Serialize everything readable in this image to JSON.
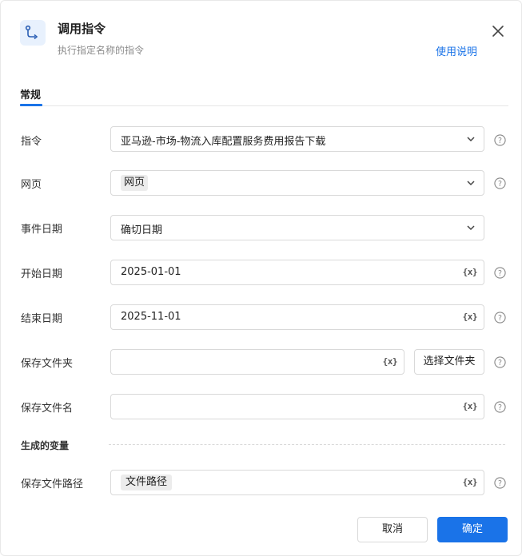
{
  "header": {
    "title": "调用指令",
    "subtitle": "执行指定名称的指令",
    "help_link": "使用说明",
    "accent": "#1a73e8"
  },
  "tabs": [
    {
      "label": "常规",
      "active": true
    }
  ],
  "form": {
    "command": {
      "label": "指令",
      "value": "亚马逊-市场-物流入库配置服务费用报告下载"
    },
    "webpage": {
      "label": "网页",
      "tag": "网页"
    },
    "event_date": {
      "label": "事件日期",
      "value": "确切日期"
    },
    "start_date": {
      "label": "开始日期",
      "value": "2025-01-01"
    },
    "end_date": {
      "label": "结束日期",
      "value": "2025-11-01"
    },
    "save_folder": {
      "label": "保存文件夹",
      "value": "",
      "button": "选择文件夹"
    },
    "save_filename": {
      "label": "保存文件名",
      "value": ""
    }
  },
  "variables": {
    "section_title": "生成的变量",
    "save_path": {
      "label": "保存文件路径",
      "tag": "文件路径"
    }
  },
  "variable_icon_text": "{x}",
  "footer": {
    "cancel": "取消",
    "confirm": "确定"
  }
}
